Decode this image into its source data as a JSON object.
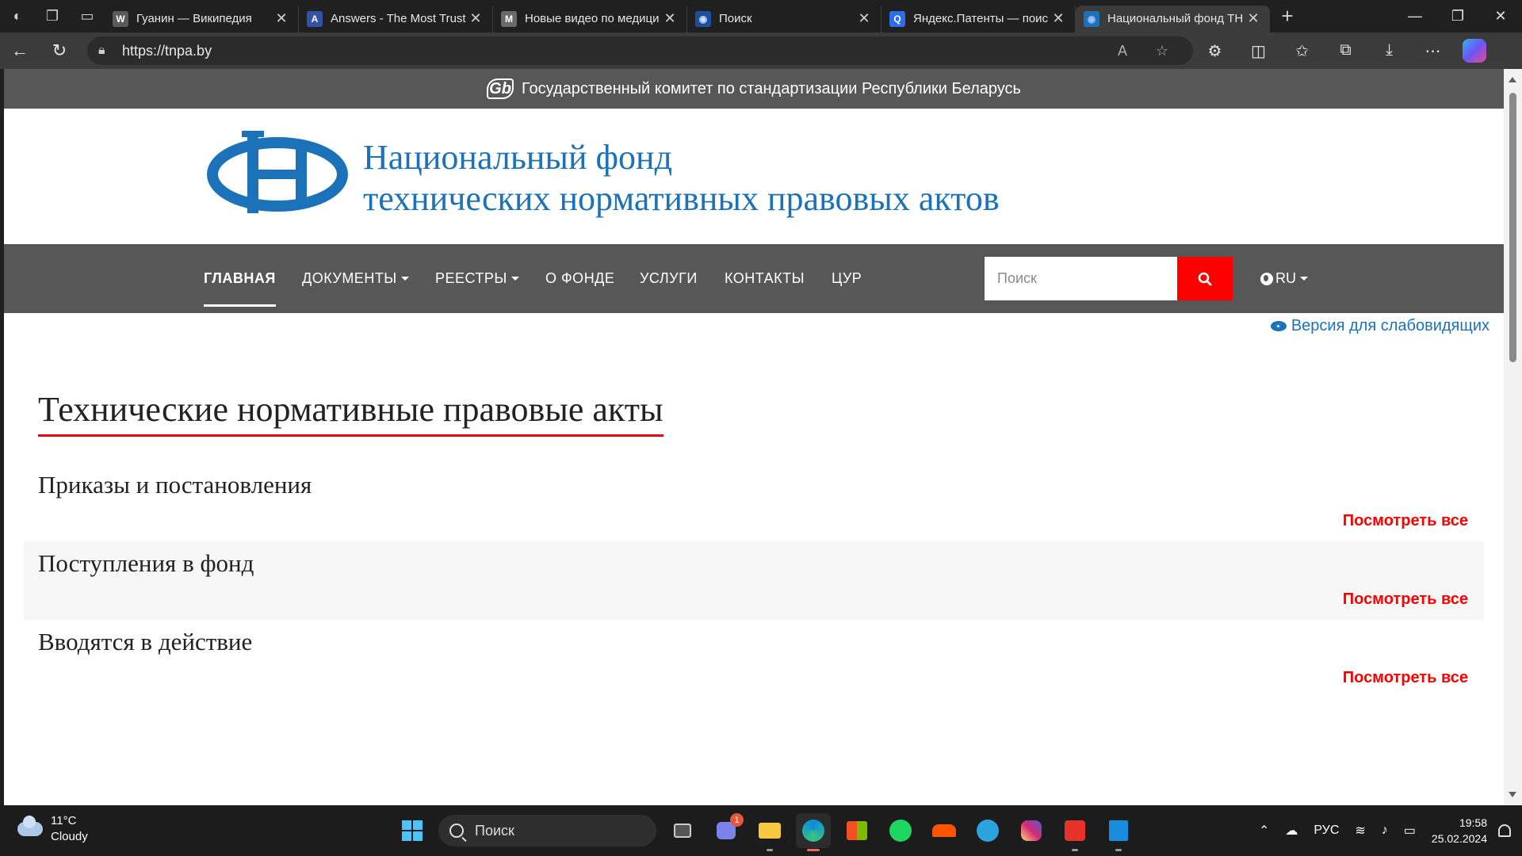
{
  "browser": {
    "tabs": [
      {
        "title": "Гуанин — Википедия",
        "favicon": "W",
        "favicon_color": "#ffffff",
        "favicon_bg": "#5a5a5a"
      },
      {
        "title": "Answers - The Most Trust",
        "favicon": "A",
        "favicon_color": "#ffffff",
        "favicon_bg": "#3551a6"
      },
      {
        "title": "Новые видео по медици",
        "favicon": "M",
        "favicon_color": "#ffffff",
        "favicon_bg": "#6a6a6a"
      },
      {
        "title": "Поиск",
        "favicon": "◉",
        "favicon_color": "#cfe0ff",
        "favicon_bg": "#1d4fa0"
      },
      {
        "title": "Яндекс.Патенты — поис",
        "favicon": "Q",
        "favicon_color": "#ffffff",
        "favicon_bg": "#2b6ee8"
      },
      {
        "title": "Национальный фонд ТН",
        "favicon": "◉",
        "favicon_color": "#9ec3ff",
        "favicon_bg": "#1b72b8",
        "active": true
      }
    ],
    "address": {
      "url": "https://tnpa.by"
    }
  },
  "site": {
    "gos_bar_text": "Государственный комитет по стандартизации Республики Беларусь",
    "gos_logo_text": "Gb",
    "name_line1": "Национальный фонд",
    "name_line2": "технических нормативных правовых актов",
    "brand_color": "#1b72b8",
    "accent_color": "#ff0000",
    "nav": {
      "items": [
        {
          "label": "ГЛАВНАЯ",
          "active": true
        },
        {
          "label": "ДОКУМЕНТЫ",
          "dropdown": true
        },
        {
          "label": "РЕЕСТРЫ",
          "dropdown": true
        },
        {
          "label": "О ФОНДЕ"
        },
        {
          "label": "УСЛУГИ"
        },
        {
          "label": "КОНТАКТЫ"
        },
        {
          "label": "ЦУР"
        }
      ],
      "search_placeholder": "Поиск",
      "lang": "RU"
    },
    "a11y_link": "Версия для слабовидящих",
    "main_title": "Технические нормативные правовые акты",
    "sections": [
      {
        "title": "Приказы и постановления",
        "view_all": "Посмотреть все"
      },
      {
        "title": "Поступления в фонд",
        "view_all": "Посмотреть все"
      },
      {
        "title": "Вводятся в действие",
        "view_all": "Посмотреть все"
      }
    ]
  },
  "taskbar": {
    "weather": {
      "temp": "11°C",
      "condition": "Cloudy"
    },
    "search_label": "Поиск",
    "chat_badge": "1",
    "lang": "РУС",
    "time": "19:58",
    "date": "25.02.2024"
  }
}
